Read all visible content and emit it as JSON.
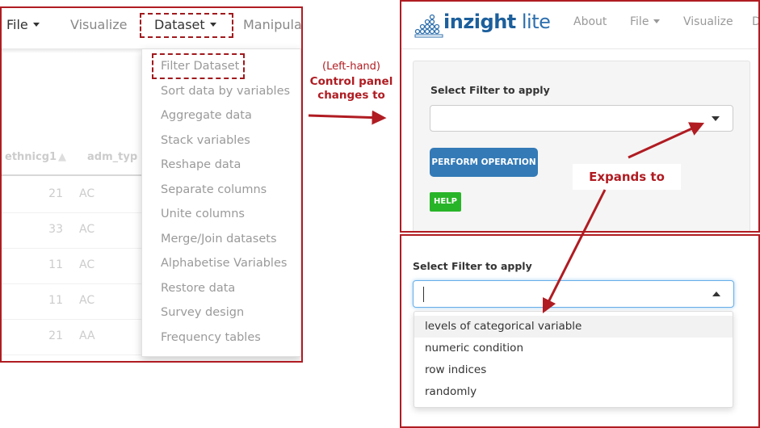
{
  "left_panel": {
    "nav": {
      "file": "File",
      "visualize": "Visualize",
      "dataset": "Dataset",
      "manipulate": "Manipula"
    },
    "table_headers": [
      "ethnicg1",
      "adm_typ"
    ],
    "rows": [
      {
        "num": "21",
        "code": "AC"
      },
      {
        "num": "33",
        "code": "AC"
      },
      {
        "num": "11",
        "code": "AC"
      },
      {
        "num": "11",
        "code": "AC"
      },
      {
        "num": "21",
        "code": "AA"
      }
    ],
    "dataset_menu": [
      "Filter Dataset",
      "Sort data by variables",
      "Aggregate data",
      "Stack variables",
      "Reshape data",
      "Separate columns",
      "Unite columns",
      "Merge/Join datasets",
      "Alphabetise Variables",
      "Restore data",
      "Survey design",
      "Frequency tables"
    ]
  },
  "annotations": {
    "left_hand": "(Left-hand)",
    "control_panel": "Control panel",
    "changes_to": "changes to",
    "expands_to": "Expands to"
  },
  "right_top": {
    "logo": {
      "main": "inzight",
      "suffix": " lite"
    },
    "nav": {
      "about": "About",
      "file": "File",
      "visualize": "Visualize",
      "cut": "D"
    },
    "select_label": "Select Filter to apply",
    "perform_button": "PERFORM OPERATION",
    "help_button": "HELP"
  },
  "right_bottom": {
    "select_label": "Select Filter to apply",
    "options": [
      "levels of categorical variable",
      "numeric condition",
      "row indices",
      "randomly"
    ]
  },
  "colors": {
    "annotation_red": "#b01c22",
    "primary_blue": "#337ab7",
    "help_green": "#28b428",
    "logo_blue": "#1c5f9c"
  }
}
